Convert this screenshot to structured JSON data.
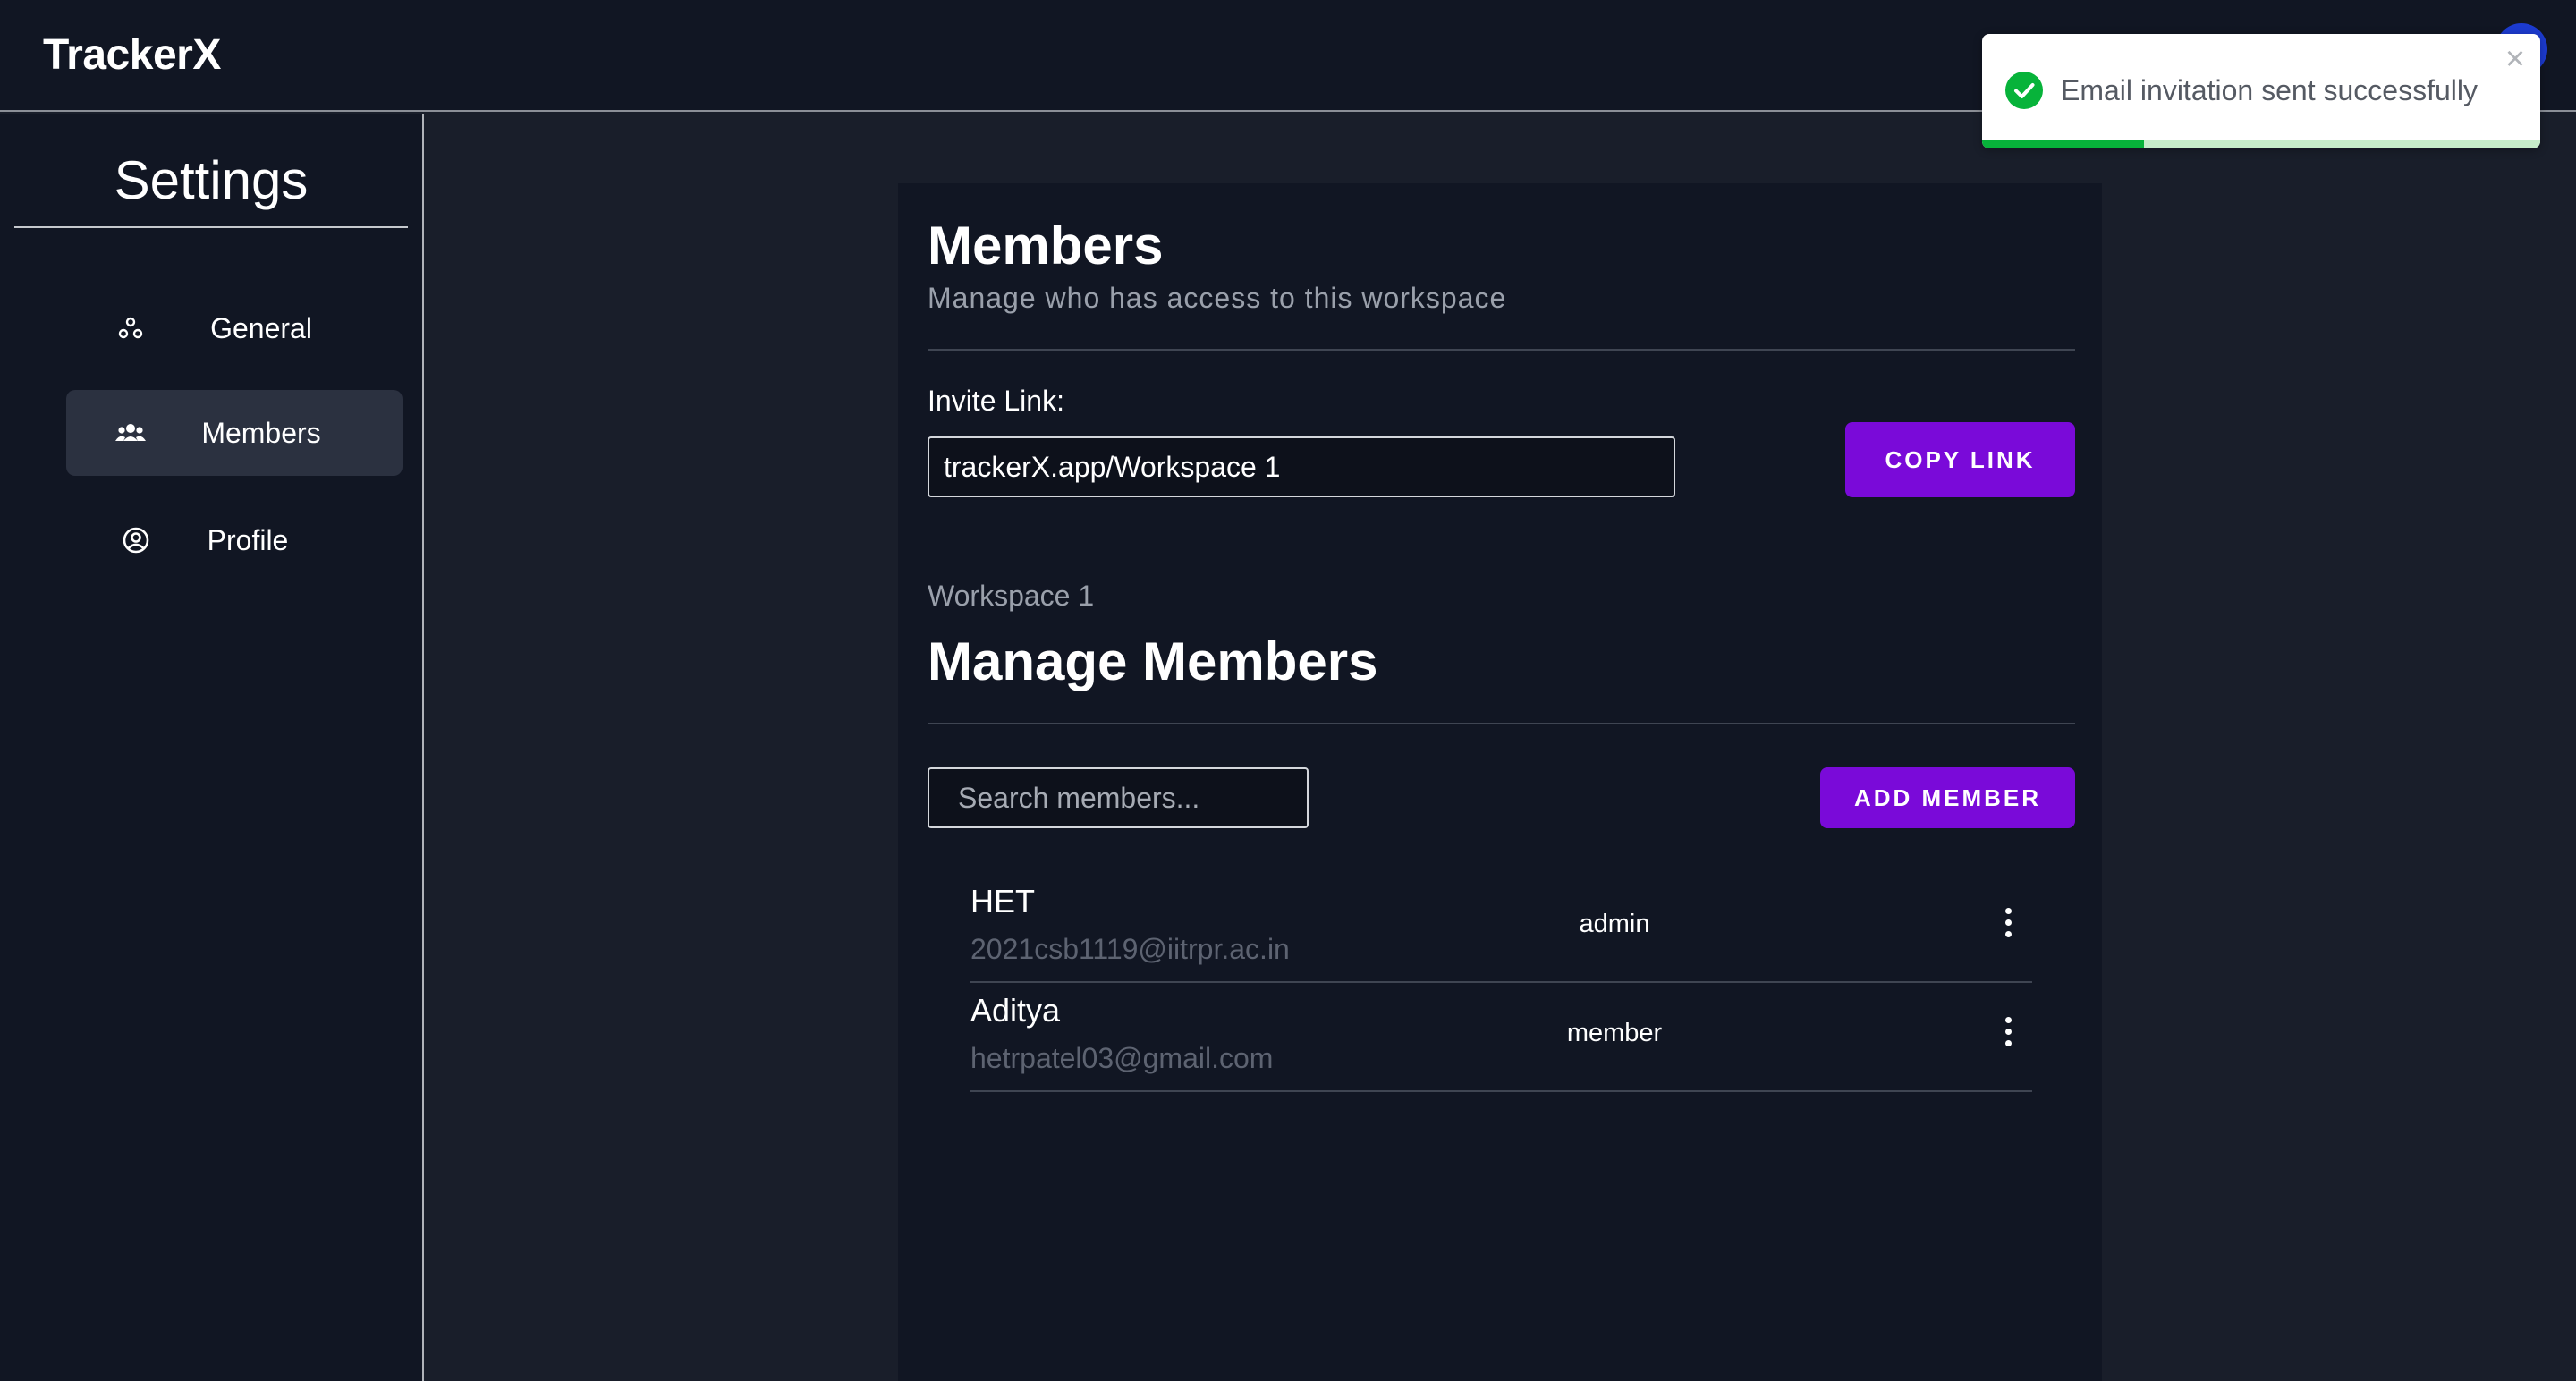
{
  "app": {
    "brand": "TrackerX"
  },
  "sidebar": {
    "title": "Settings",
    "items": [
      {
        "label": "General",
        "icon": "workspace-icon",
        "active": false
      },
      {
        "label": "Members",
        "icon": "people-icon",
        "active": true
      },
      {
        "label": "Profile",
        "icon": "user-circle-icon",
        "active": false
      }
    ]
  },
  "members_section": {
    "title": "Members",
    "subtitle": "Manage who has access to this workspace",
    "invite_label": "Invite Link:",
    "invite_link": "trackerX.app/Workspace 1",
    "copy_button": "COPY LINK"
  },
  "manage_section": {
    "workspace_name": "Workspace 1",
    "title": "Manage Members",
    "search_placeholder": "Search members...",
    "add_button": "ADD MEMBER"
  },
  "members": [
    {
      "name": "HET",
      "email": "2021csb1119@iitrpr.ac.in",
      "role": "admin"
    },
    {
      "name": "Aditya",
      "email": "hetrpatel03@gmail.com",
      "role": "member"
    }
  ],
  "toast": {
    "message": "Email invitation sent successfully",
    "close": "×",
    "progress": 0.29,
    "color": "#07b33a"
  },
  "colors": {
    "accent": "#7a0ad9",
    "background": "#191e2a",
    "panel": "#111623",
    "success": "#07b33a"
  }
}
